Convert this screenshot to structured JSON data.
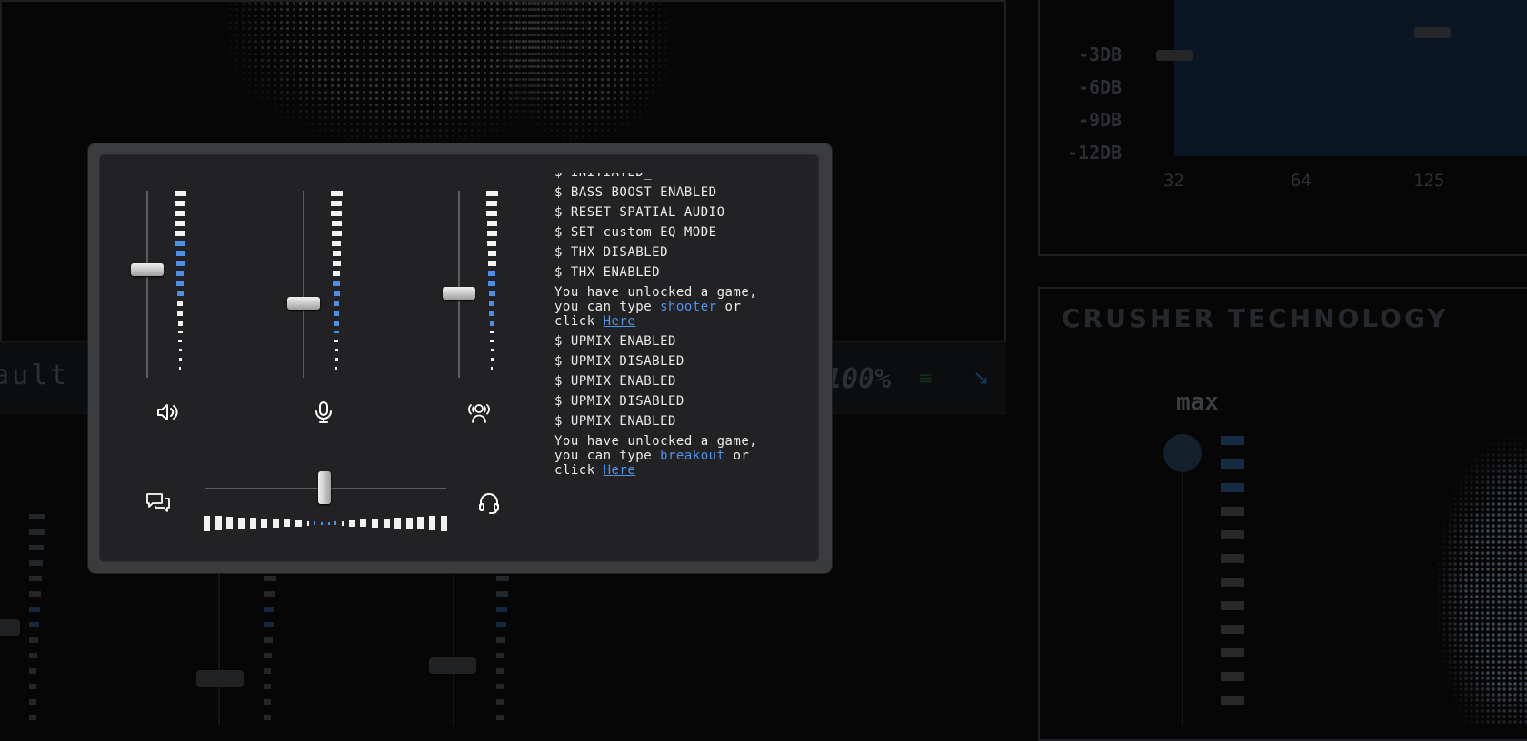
{
  "background": {
    "default_label": "ault",
    "percent_label": "100%",
    "eq_db_labels": [
      "-3DB",
      "-6DB",
      "-9DB",
      "-12DB"
    ],
    "eq_freq_labels": [
      "32",
      "64",
      "125"
    ],
    "crusher_title": "CRUSHER TECHNOLOGY",
    "crusher_max_label": "max"
  },
  "mixer": {
    "channels": [
      {
        "id": "speaker",
        "icon": "speaker-icon",
        "level": 0.58
      },
      {
        "id": "microphone",
        "icon": "microphone-icon",
        "level": 0.4
      },
      {
        "id": "spatial",
        "icon": "spatial-audio-icon",
        "level": 0.45
      }
    ],
    "balance": {
      "left_icon": "chat-icon",
      "right_icon": "headset-icon",
      "level": 0.5
    }
  },
  "console": {
    "top_partial": "$ INITIATED_",
    "group1": [
      "$ BASS BOOST ENABLED",
      "$ RESET SPATIAL AUDIO",
      "$ SET custom EQ MODE",
      "$ THX DISABLED",
      "$ THX ENABLED"
    ],
    "unlock1": {
      "line1": "You have unlocked a game,",
      "prefix": "you can type ",
      "keyword": "shooter",
      "suffix": " or",
      "click": "click ",
      "link": "Here"
    },
    "group2": [
      "$ UPMIX ENABLED",
      "$ UPMIX DISABLED",
      "$ UPMIX ENABLED",
      "$ UPMIX DISABLED",
      "$ UPMIX ENABLED"
    ],
    "unlock2": {
      "line1": "You have unlocked a game,",
      "prefix": "you can type ",
      "keyword": "breakout",
      "suffix": " or",
      "click": "click ",
      "link": "Here"
    }
  },
  "colors": {
    "accent_blue": "#4c8fe6",
    "panel": "#222123"
  }
}
